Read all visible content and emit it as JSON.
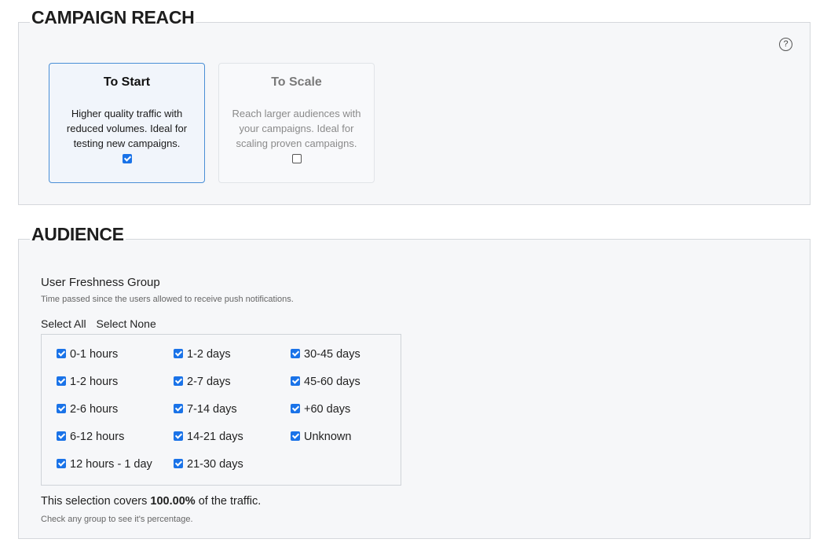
{
  "campaign_reach": {
    "title": "CAMPAIGN REACH",
    "help_icon": "?",
    "options": [
      {
        "title": "To Start",
        "description": "Higher quality traffic with reduced volumes. Ideal for testing new campaigns.",
        "checked": true
      },
      {
        "title": "To Scale",
        "description": "Reach larger audiences with your campaigns. Ideal for scaling proven campaigns.",
        "checked": false
      }
    ]
  },
  "audience": {
    "title": "AUDIENCE",
    "group_label": "User Freshness Group",
    "group_hint": "Time passed since the users allowed to receive push notifications.",
    "select_all": "Select All",
    "select_none": "Select None",
    "columns": [
      [
        {
          "label": "0-1 hours",
          "checked": true
        },
        {
          "label": "1-2 hours",
          "checked": true
        },
        {
          "label": "2-6 hours",
          "checked": true
        },
        {
          "label": "6-12 hours",
          "checked": true
        },
        {
          "label": "12 hours - 1 day",
          "checked": true
        }
      ],
      [
        {
          "label": "1-2 days",
          "checked": true
        },
        {
          "label": "2-7 days",
          "checked": true
        },
        {
          "label": "7-14 days",
          "checked": true
        },
        {
          "label": "14-21 days",
          "checked": true
        },
        {
          "label": "21-30 days",
          "checked": true
        }
      ],
      [
        {
          "label": "30-45 days",
          "checked": true
        },
        {
          "label": "45-60 days",
          "checked": true
        },
        {
          "label": "+60 days",
          "checked": true
        },
        {
          "label": "Unknown",
          "checked": true
        }
      ]
    ],
    "coverage_prefix": "This selection covers ",
    "coverage_value": "100.00%",
    "coverage_suffix": " of the traffic.",
    "coverage_hint": "Check any group to see it's percentage."
  },
  "colors": {
    "accent": "#1a73e8",
    "selected_card_border": "#4a8fd6"
  }
}
